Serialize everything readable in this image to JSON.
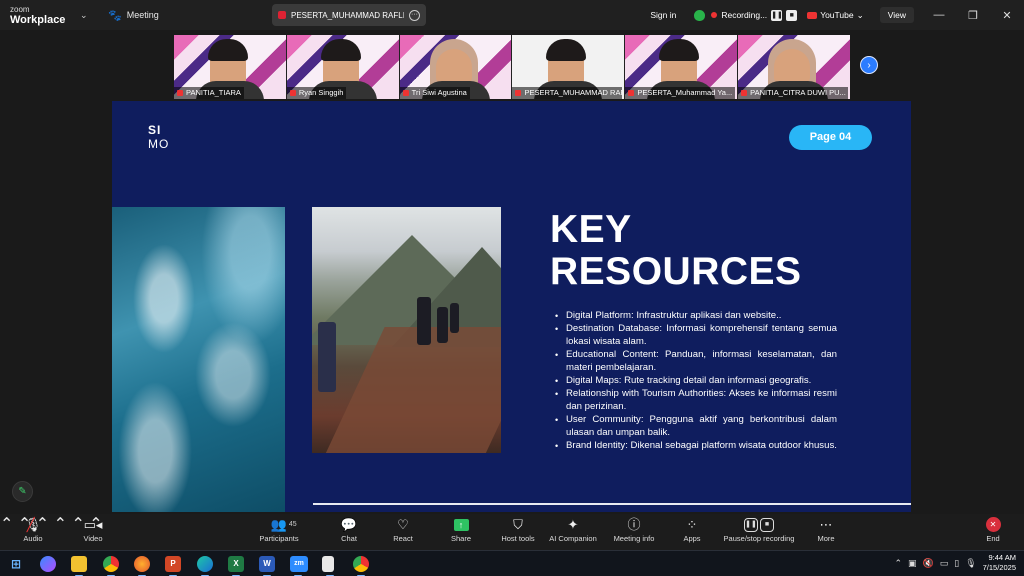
{
  "window": {
    "brand_top": "zoom",
    "brand_bottom": "Workplace",
    "meeting_label": "Meeting",
    "share_tab": "PESERTA_MUHAMMAD RAFLI's sc",
    "sign_in": "Sign in",
    "recording": "Recording...",
    "youtube": "YouTube",
    "view": "View"
  },
  "gallery": [
    {
      "name": "PANITIA_TIARA",
      "style": "hair"
    },
    {
      "name": "Ryan Singgih",
      "style": "hair"
    },
    {
      "name": "Tri Siwi Agustina",
      "style": "hijab"
    },
    {
      "name": "PESERTA_MUHAMMAD RAFLI",
      "style": "hair"
    },
    {
      "name": "PESERTA_Muhammad Ya...",
      "style": "hair"
    },
    {
      "name": "PANITIA_CITRA DUWI PU...",
      "style": "hijab"
    }
  ],
  "slide": {
    "logo_line1": "SI",
    "logo_line2": "MO",
    "page_badge": "Page 04",
    "heading_line1": "KEY",
    "heading_line2": "RESOURCES",
    "bullets": [
      "Digital Platform: Infrastruktur aplikasi dan website..",
      "Destination Database: Informasi komprehensif tentang semua lokasi wisata alam.",
      "Educational Content: Panduan, informasi keselamatan, dan materi pembelajaran.",
      "Digital Maps: Rute tracking detail dan informasi geografis.",
      "Relationship with Tourism Authorities: Akses ke informasi resmi dan perizinan.",
      "User Community: Pengguna aktif yang berkontribusi dalam ulasan dan umpan balik.",
      "Brand Identity: Dikenal sebagai platform wisata outdoor khusus."
    ]
  },
  "toolbar": {
    "audio": "Audio",
    "video": "Video",
    "participants": "Participants",
    "participants_count": "45",
    "chat": "Chat",
    "react": "React",
    "share": "Share",
    "host_tools": "Host tools",
    "ai_companion": "AI Companion",
    "meeting_info": "Meeting info",
    "apps": "Apps",
    "pause_stop": "Pause/stop recording",
    "more": "More",
    "end": "End"
  },
  "taskbar": {
    "time": "9:44 AM",
    "date": "7/15/2025",
    "apps": [
      "file-explorer",
      "chrome",
      "firefox",
      "powerpoint",
      "edge",
      "excel",
      "word",
      "zoom",
      "notepad",
      "chrome-2"
    ]
  },
  "colors": {
    "slide_bg": "#0f1d5e",
    "page_badge": "#29b6f6",
    "active_speaker": "#2fdc5a",
    "share_green": "#2ec263",
    "end_red": "#d9303d"
  }
}
